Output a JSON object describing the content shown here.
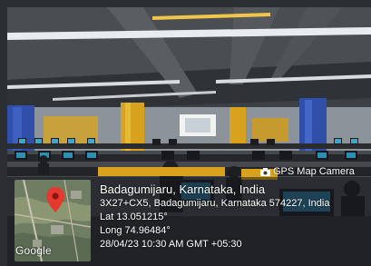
{
  "stamp": {
    "app_label": "GPS Map Camera",
    "camera_icon": "camera-icon",
    "location_title": "Badagumijaru, Karnataka, India",
    "address": "3X27+CX5, Badagumijaru, Karnataka 574227, India",
    "latitude": "Lat 13.051215°",
    "longitude": "Long 74.96484°",
    "datetime": "28/04/23 10:30 AM GMT +05:30"
  },
  "map": {
    "attribution": "Google",
    "pin_icon": "map-pin-icon",
    "pin_color": "#e5392f"
  },
  "colors": {
    "ceiling": "#4a4d52",
    "pillar_blue": "#2f4fa8",
    "pillar_yellow": "#d8a21e",
    "overlay": "#14161a"
  }
}
